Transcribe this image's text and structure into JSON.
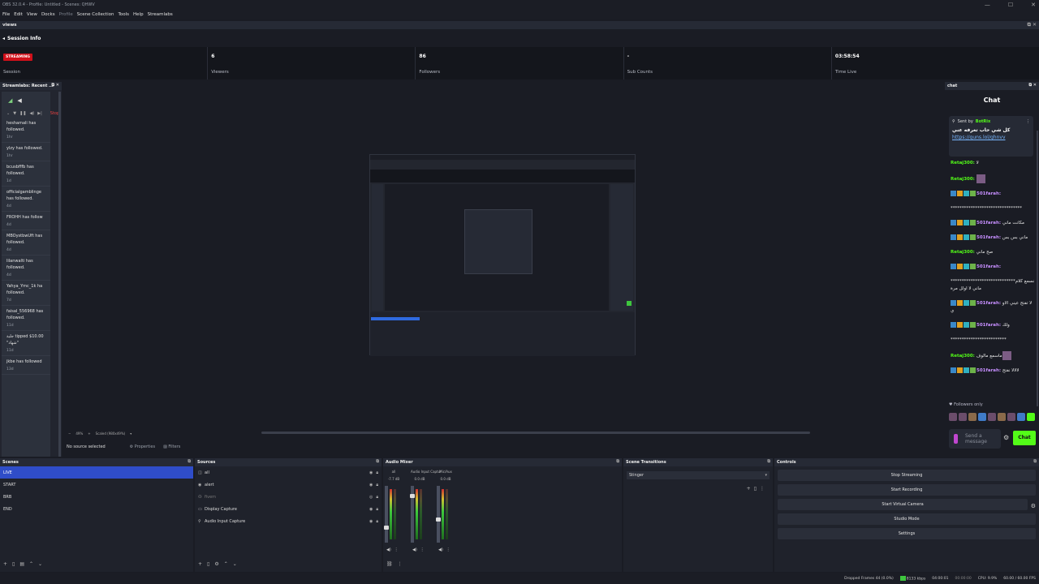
{
  "window": {
    "title": "OBS 32.0.4 - Profile: Untitled - Scenes: QHWV",
    "min": "—",
    "max": "☐",
    "close": "✕"
  },
  "menu": [
    "File",
    "Edit",
    "View",
    "Docks",
    "Profile",
    "Scene Collection",
    "Tools",
    "Help",
    "Streamlabs"
  ],
  "views_title": "views",
  "session": {
    "title": "Session Info",
    "badge": "STREAMING",
    "session_label": "Session",
    "viewers": "6",
    "viewers_label": "Viewers",
    "followers": "86",
    "followers_label": "Followers",
    "subs": "-",
    "subs_label": "Sub Counts",
    "time": "03:58:54",
    "time_label": "Time Live"
  },
  "recent": {
    "title": "Streamlabs: Recent ...",
    "stop": "Stop",
    "events": [
      {
        "text": "heshamali has followed.",
        "age": "1hr"
      },
      {
        "text": "ylzy has followed.",
        "age": "1hr"
      },
      {
        "text": "bcusbfffb has followed.",
        "age": "1d"
      },
      {
        "text": "officialgamblinge has followed.",
        "age": "4d"
      },
      {
        "text": "FROHH has follow",
        "age": "4d"
      },
      {
        "text": "MBOystbwUft has followed.",
        "age": "4d"
      },
      {
        "text": "lilanwalti has followed.",
        "age": "4d"
      },
      {
        "text": "Yahya_Ymc_1k ha followed.",
        "age": "7d"
      },
      {
        "text": "faisal_556968 has followed.",
        "age": "11d"
      },
      {
        "text": "جلبة tipped $10.00 \"شهاد\"",
        "age": "11d"
      },
      {
        "text": "jkbe has followed",
        "age": "13d"
      }
    ]
  },
  "preview": {
    "zoom": "49%",
    "scale": "Scaled (980x49%)"
  },
  "source_bar": {
    "no_source": "No source selected",
    "properties": "Properties",
    "filters": "Filters"
  },
  "chat": {
    "dock_title": "chat",
    "title": "Chat",
    "pinned_sent": "Sent by",
    "pinned_user": "BotRix",
    "pinned_msg": "كل شي حاب تعرفه عني",
    "pinned_link": "https://guns.lol/ghnvv",
    "messages": [
      {
        "user": "Retaj300:",
        "text": "لا",
        "cls": "u1"
      },
      {
        "user": "Retaj300:",
        "text": "",
        "cls": "u1",
        "emote": true
      },
      {
        "user": "501farah:",
        "text": "",
        "cls": "u2",
        "badges": true
      },
      {
        "user": "",
        "text": "********************************",
        "cls": "u2"
      },
      {
        "user": "501farah:",
        "text": "مكانت ماني",
        "cls": "u2",
        "badges": true
      },
      {
        "user": "501farah:",
        "text": "ماني بس بس",
        "cls": "u2",
        "badges": true
      },
      {
        "user": "Retaj300:",
        "text": "صح ماني",
        "cls": "u1"
      },
      {
        "user": "501farah:",
        "text": "",
        "cls": "u2",
        "badges": true
      },
      {
        "user": "",
        "text": "*****************************نسمع كلام ماني لا اولل مرة",
        "cls": "u2"
      },
      {
        "user": "501farah:",
        "text": "لا تفتح عيني الاوي",
        "cls": "u2",
        "badges": true
      },
      {
        "user": "501farah:",
        "text": "ولك",
        "cls": "u2",
        "badges": true
      },
      {
        "user": "",
        "text": "*************************",
        "cls": "u2"
      },
      {
        "user": "Retaj300:",
        "text": "ماسمع مالوف",
        "cls": "u1",
        "emote": true
      },
      {
        "user": "501farah:",
        "text": "لالالا نفتح",
        "cls": "u2",
        "badges": true
      }
    ],
    "followers_only": "Followers only",
    "placeholder": "Send a message",
    "send": "Chat"
  },
  "scenes": {
    "title": "Scenes",
    "items": [
      "LIVE",
      "START",
      "BRB",
      "END"
    ]
  },
  "sources": {
    "title": "Sources",
    "items": [
      {
        "name": "all",
        "icon": "◫"
      },
      {
        "name": "alert",
        "icon": "◉"
      },
      {
        "name": "fivem",
        "icon": "⚇"
      },
      {
        "name": "Display Capture",
        "icon": "▭"
      },
      {
        "name": "Audio Input Capture",
        "icon": "⚲"
      }
    ]
  },
  "mixer": {
    "title": "Audio Mixer",
    "channels": [
      {
        "name": "all",
        "db": "-7.7 dB",
        "level": 0.75
      },
      {
        "name": "Audio Input Captur",
        "db": "0.0 dB",
        "level": 0.15
      },
      {
        "name": "Mic/Aux",
        "db": "0.0 dB",
        "level": 0.6
      }
    ]
  },
  "transitions": {
    "title": "Scene Transitions",
    "selected": "Stinger"
  },
  "controls": {
    "title": "Controls",
    "buttons": [
      "Stop Streaming",
      "Start Recording",
      "Start Virtual Camera",
      "Studio Mode",
      "Settings"
    ]
  },
  "status": {
    "dropped": "Dropped Frames 44 (0.0%)",
    "bitrate": "8133 kbps",
    "stream_time": "04:00:01",
    "rec_time": "00:00:00",
    "cpu": "CPU: 9.9%",
    "fps": "60.00 / 60.00 FPS"
  }
}
